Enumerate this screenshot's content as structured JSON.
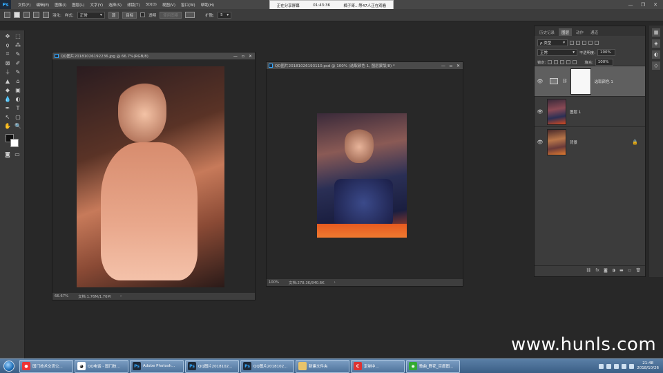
{
  "app": {
    "logo": "Ps",
    "menu": [
      "文件(F)",
      "编辑(E)",
      "图像(I)",
      "图层(L)",
      "文字(Y)",
      "选择(S)",
      "滤镜(T)",
      "3D(D)",
      "视图(V)",
      "窗口(W)",
      "帮助(H)"
    ],
    "window_controls": [
      "—",
      "❐",
      "✕"
    ]
  },
  "share_banner": {
    "status": "正在分享屏幕",
    "time": "01:43:36",
    "viewers": "楠子哥...等47人正在观看"
  },
  "options_bar": {
    "feather_label": "羽化:",
    "style_label": "样式:",
    "style_value": "正常",
    "source_btn": "源",
    "target_btn": "目标",
    "transparent_label": "透明",
    "use_pattern_btn": "使用图案",
    "diffusion_label": "扩散:",
    "diffusion_value": "5"
  },
  "tools": [
    "✥",
    "⬚",
    "ϙ",
    "⁂",
    "⌗",
    "✎",
    "⊠",
    "✐",
    "⍊",
    "✎",
    "▲",
    "⌂",
    "◆",
    "▣",
    "💧",
    "◐",
    "✒",
    "T",
    "↖",
    "▢",
    "✋",
    "🔍",
    "…",
    ""
  ],
  "doc1": {
    "title": "QQ图片20181026192236.jpg @ 66.7%(RGB/8)",
    "zoom": "66.67%",
    "doc_info": "文档:1.76M/1.76M"
  },
  "doc2": {
    "title": "QQ图片20181026193110.psd @ 100% (选取颜色 1, 图层蒙版/8) *",
    "zoom": "100%",
    "doc_info": "文档:278.3K/840.6K"
  },
  "panel": {
    "tabs": [
      "历史记录",
      "图层",
      "动作",
      "通道"
    ],
    "active_tab": "图层",
    "filter_kind": "ρ 类型",
    "blend_mode": "正常",
    "opacity_label": "不透明度:",
    "opacity_value": "100%",
    "lock_label": "锁定:",
    "fill_label": "填充:",
    "fill_value": "100%",
    "layers": [
      {
        "name": "选取颜色 1",
        "type": "adjustment",
        "selected": true
      },
      {
        "name": "图层 1",
        "type": "image",
        "selected": false
      },
      {
        "name": "背景",
        "type": "image",
        "selected": false,
        "locked": true
      }
    ],
    "footer_icons": [
      "⛓",
      "fx",
      "◙",
      "◑",
      "▬",
      "▭",
      "🗑"
    ]
  },
  "watermark": "www.hunls.com",
  "taskbar": {
    "tasks": [
      {
        "label": "国门技术交流公...",
        "icon": "●",
        "icon_color": "#e33"
      },
      {
        "label": "QQ电话 - 国门技...",
        "icon": "🐧",
        "icon_color": "#111"
      },
      {
        "label": "Adobe Photosh...",
        "icon": "Ps",
        "icon_color": "#1e2a3a"
      },
      {
        "label": "QQ图片2018102...",
        "icon": "Ps",
        "icon_color": "#1e2a3a"
      },
      {
        "label": "QQ图片2018102...",
        "icon": "Ps",
        "icon_color": "#1e2a3a"
      },
      {
        "label": "新建文件夹",
        "icon": "▮",
        "icon_color": "#e9c46a"
      },
      {
        "label": "定制中...",
        "icon": "C",
        "icon_color": "#d33"
      },
      {
        "label": "歌曲_野花_百度图...",
        "icon": "◉",
        "icon_color": "#3a3"
      }
    ],
    "time": "21:48",
    "date": "2018/10/26"
  }
}
